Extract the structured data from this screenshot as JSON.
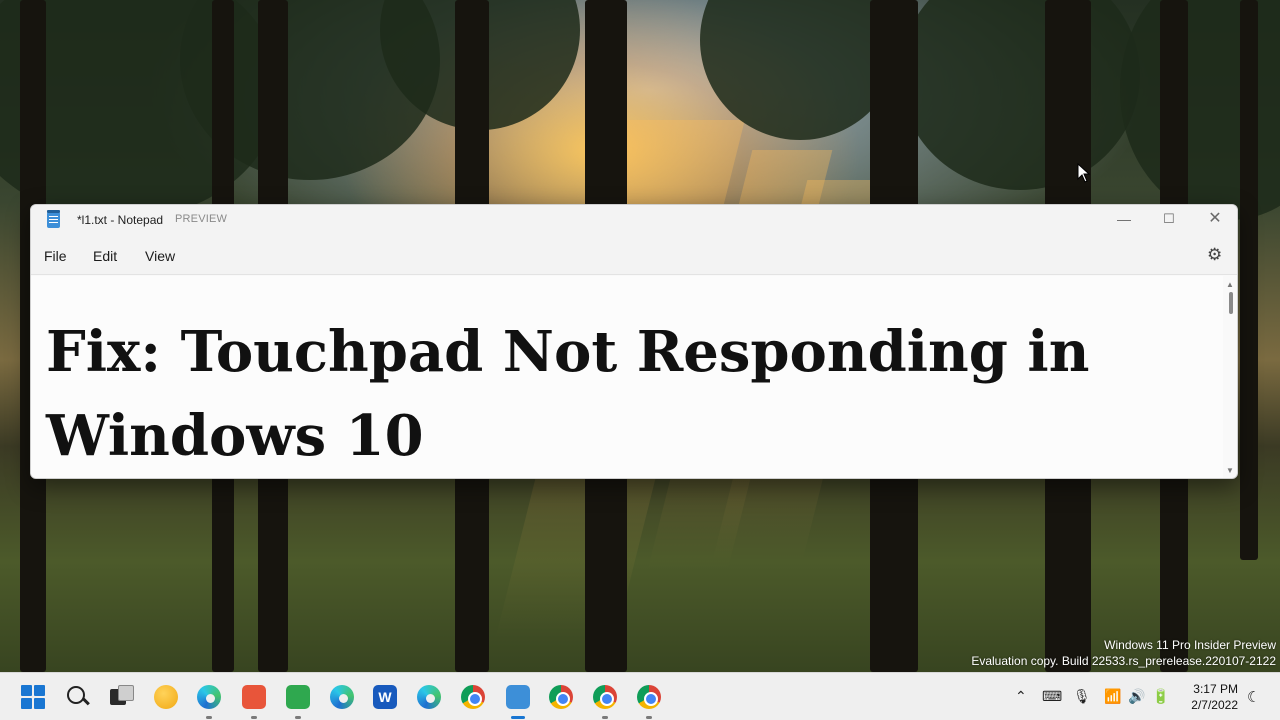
{
  "window": {
    "title": "*l1.txt - Notepad",
    "preview_tag": "PREVIEW",
    "controls": {
      "minimize": "—",
      "maximize": "☐",
      "close": "✕"
    },
    "menu": [
      "File",
      "Edit",
      "View"
    ],
    "settings_icon": "⚙",
    "editor_text": "Fix: Touchpad Not Responding in\nWindows 10"
  },
  "watermark": {
    "line1": "Windows 11 Pro Insider Preview",
    "line2": "Evaluation copy. Build 22533.rs_prerelease.220107-2122"
  },
  "taskbar": {
    "pinned_icons": [
      "start-icon",
      "search-icon",
      "task-view-icon",
      "file-explorer-icon",
      "edge-icon",
      "clipchamp-icon",
      "camtasia-icon",
      "edge-beta-icon",
      "word-icon",
      "edge-dev-icon",
      "chrome-icon",
      "notepad-icon",
      "chrome-icon",
      "chrome-canary-icon",
      "chrome-dev-icon"
    ],
    "tray": {
      "chevron": "⌃",
      "keyboard": "⌨",
      "mic": "🎙",
      "wifi": "📶",
      "volume": "🔊",
      "battery": "🔋"
    },
    "time": "3:17 PM",
    "date": "2/7/2022",
    "moon": "☾"
  },
  "colors": {
    "accent": "#1976d2"
  }
}
